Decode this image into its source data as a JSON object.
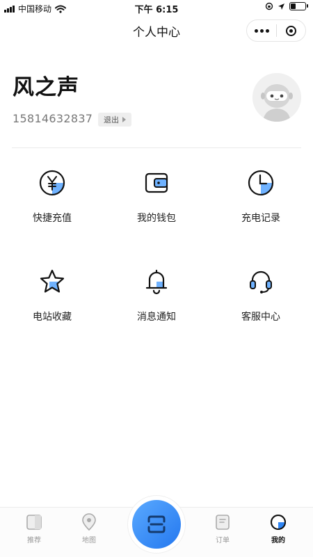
{
  "status_bar": {
    "carrier": "中国移动",
    "time": "下午 6:15"
  },
  "nav": {
    "title": "个人中心"
  },
  "profile": {
    "name": "风之声",
    "phone": "15814632837",
    "logout_label": "退出"
  },
  "menu": [
    {
      "label": "快捷充值",
      "icon": "yuan-coin-icon"
    },
    {
      "label": "我的钱包",
      "icon": "wallet-icon"
    },
    {
      "label": "充电记录",
      "icon": "clock-icon"
    },
    {
      "label": "电站收藏",
      "icon": "star-icon"
    },
    {
      "label": "消息通知",
      "icon": "bell-icon"
    },
    {
      "label": "客服中心",
      "icon": "headset-icon"
    }
  ],
  "tabs": [
    {
      "label": "推荐",
      "icon": "recommend-icon"
    },
    {
      "label": "地图",
      "icon": "map-pin-icon"
    },
    {
      "label": "订单",
      "icon": "order-icon"
    },
    {
      "label": "我的",
      "icon": "profile-icon",
      "active": true
    }
  ],
  "colors": {
    "accent": "#2f86f5",
    "accent_light": "#6fb2ff"
  }
}
